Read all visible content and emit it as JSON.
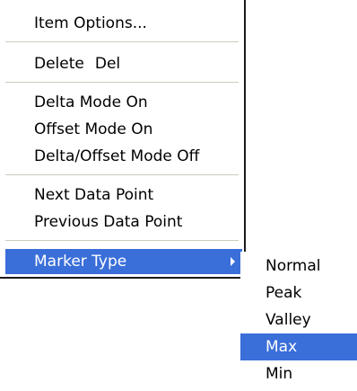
{
  "menu": {
    "item_options": "Item Options...",
    "delete": {
      "label": "Delete",
      "shortcut": "Del"
    },
    "delta_mode_on": "Delta Mode On",
    "offset_mode_on": "Offset Mode On",
    "delta_offset_mode_off": "Delta/Offset Mode Off",
    "next_data_point": "Next Data Point",
    "previous_data_point": "Previous Data Point",
    "marker_type": "Marker Type"
  },
  "submenu": {
    "items": [
      "Normal",
      "Peak",
      "Valley",
      "Max",
      "Min"
    ],
    "selected": "Max"
  },
  "colors": {
    "highlight": "#3a6ed9",
    "highlight_text": "#ffffff",
    "separator": "#cbcbbd",
    "menu_border": "#1a1a1a"
  }
}
